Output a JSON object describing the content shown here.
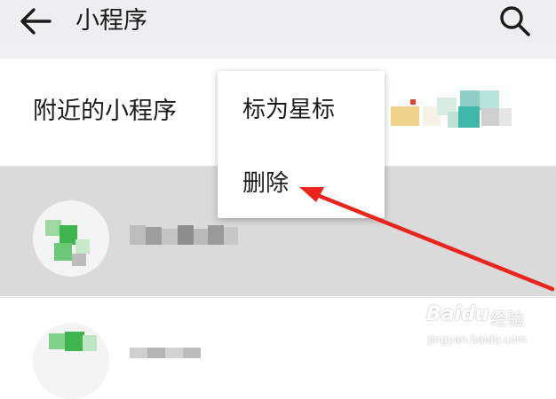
{
  "header": {
    "back_icon": "arrow-left-icon",
    "title": "小程序",
    "search_icon": "search-icon"
  },
  "nearby": {
    "label": "附近的小程序"
  },
  "context_menu": {
    "items": [
      {
        "label": "标为星标"
      },
      {
        "label": "删除"
      }
    ]
  },
  "watermark": {
    "brand": "Baidu",
    "experience": "经验",
    "url": "jingyan.baidu.com"
  },
  "colors": {
    "header_bg": "#eeeef0",
    "selected_row_bg": "#dadada",
    "annotation_arrow": "#e8241c",
    "avatar_green": "#4cc25c"
  }
}
